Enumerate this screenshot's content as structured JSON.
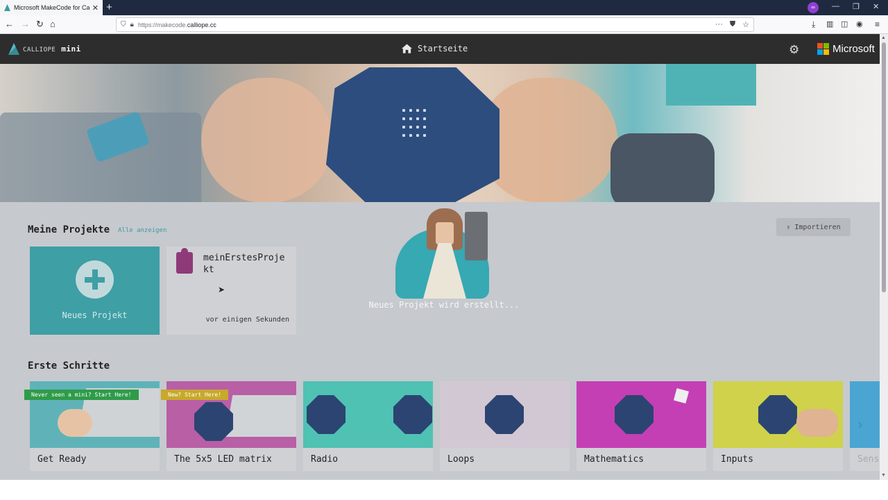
{
  "browser": {
    "tab_title": "Microsoft MakeCode for Callio",
    "tab_close": "✕",
    "new_tab": "+",
    "url_prefix": "https://makecode.",
    "url_host": "calliope.cc"
  },
  "header": {
    "logo_brand": "CALLIOPE",
    "logo_mini": "mini",
    "home_label": "Startseite",
    "microsoft_label": "Microsoft"
  },
  "projects": {
    "heading": "Meine Projekte",
    "show_all": "Alle anzeigen",
    "import_label": "Importieren",
    "new_project_label": "Neues Projekt",
    "project_name": "meinErstesProjekt",
    "project_time": "vor einigen Sekunden"
  },
  "loading": {
    "message": "Neues Projekt wird erstellt..."
  },
  "gallery": {
    "heading": "Erste Schritte",
    "cards": [
      {
        "title": "Get Ready",
        "ribbon": "Never seen a mini? Start Here!",
        "ribbon_color": "#2f9b4a",
        "bg": "#5fb3b8"
      },
      {
        "title": "The 5x5 LED matrix",
        "ribbon": "New? Start Here!",
        "ribbon_color": "#c9a82a",
        "bg": "#b85fa6"
      },
      {
        "title": "Radio",
        "ribbon": "",
        "bg": "#4fc2b3"
      },
      {
        "title": "Loops",
        "ribbon": "",
        "bg": "#d2c8d4"
      },
      {
        "title": "Mathematics",
        "ribbon": "",
        "bg": "#c43fb4"
      },
      {
        "title": "Inputs",
        "ribbon": "",
        "bg": "#cfd24a"
      },
      {
        "title": "Sens",
        "ribbon": "",
        "bg": "#4aa5d2"
      }
    ]
  },
  "colors": {
    "accent": "#3e9fa5",
    "header_bg": "#2d2d2d",
    "puzzle": "#8f3a78"
  }
}
